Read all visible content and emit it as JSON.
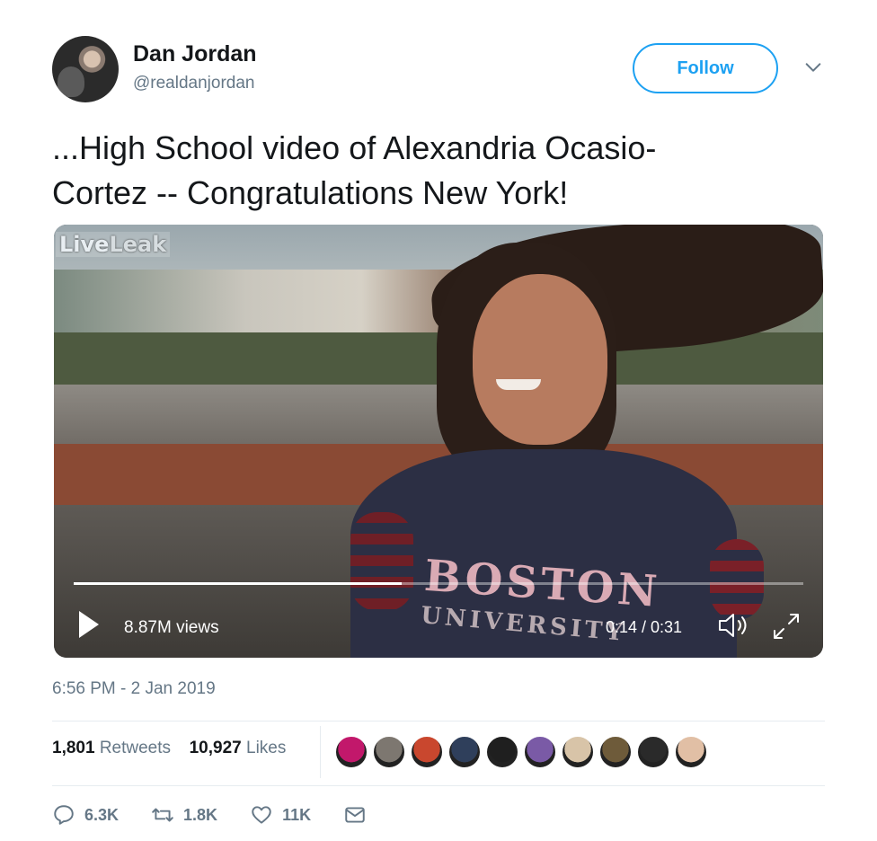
{
  "user": {
    "name": "Dan Jordan",
    "handle": "@realdanjordan",
    "follow_label": "Follow"
  },
  "tweet": {
    "text_line1": "...High School video of Alexandria Ocasio-",
    "text_line2": "Cortez -- Congratulations New York!",
    "timestamp": "6:56 PM - 2 Jan 2019"
  },
  "video": {
    "watermark_live": "Live",
    "watermark_leak": "Leak",
    "shirt_line1": "BOSTON",
    "shirt_line2": "UNIVERSITY",
    "views": "8.87M views",
    "time": "0:14 / 0:31",
    "progress_fraction": 0.45
  },
  "stats": {
    "retweets_count": "1,801",
    "retweets_label": "Retweets",
    "likes_count": "10,927",
    "likes_label": "Likes"
  },
  "likers": [
    {
      "name": "liker-avatar-1",
      "color": "#c2186b"
    },
    {
      "name": "liker-avatar-2",
      "color": "#7d7770"
    },
    {
      "name": "liker-avatar-3",
      "color": "#c9472e"
    },
    {
      "name": "liker-avatar-4",
      "color": "#2f3f5b"
    },
    {
      "name": "liker-avatar-5",
      "color": "#1f1f1f"
    },
    {
      "name": "liker-avatar-6",
      "color": "#7a5aa6"
    },
    {
      "name": "liker-avatar-7",
      "color": "#d8c4a8"
    },
    {
      "name": "liker-avatar-8",
      "color": "#6e5b3a"
    },
    {
      "name": "liker-avatar-9",
      "color": "#2a2a2a"
    },
    {
      "name": "liker-avatar-10",
      "color": "#e1bfa5"
    }
  ],
  "actions": {
    "replies": "6.3K",
    "retweets": "1.8K",
    "likes": "11K"
  },
  "colors": {
    "accent": "#1da1f2",
    "secondary_text": "#657786"
  }
}
